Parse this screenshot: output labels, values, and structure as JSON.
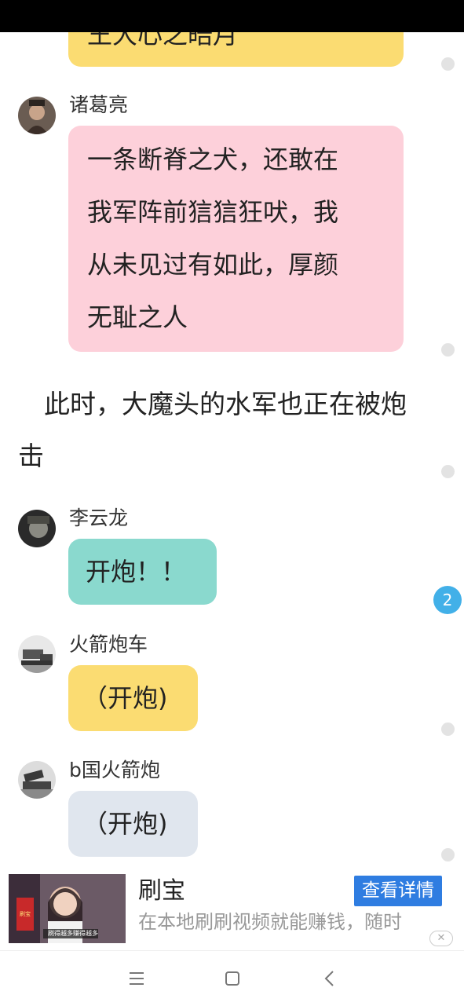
{
  "messages": [
    {
      "text": "王大心之皓月",
      "color": "#fbdc72"
    },
    {
      "name": "诸葛亮",
      "text": "一条断脊之犬，还敢在\n我军阵前狺狺狂吠，我\n从未见过有如此，厚颜\n无耻之人",
      "color": "#fdd0da"
    },
    {
      "name": "李云龙",
      "text": "开炮！！",
      "color": "#8ad9ce"
    },
    {
      "name": "火箭炮车",
      "text": "（开炮)",
      "color": "#fbdc72"
    },
    {
      "name": "b国火箭炮",
      "text": "（开炮)",
      "color": "#e0e6ee"
    }
  ],
  "narration": "　此时，大魔头的水军也正在被炮击",
  "badge": "2",
  "ad": {
    "title": "刷宝",
    "description": "在本地刷刷视频就能赚钱，随时",
    "button": "查看详情",
    "close": "✕",
    "thumb_caption": "刷得越多赚得越多",
    "thumb_badge": "刷宝"
  },
  "icons": {
    "menu": "menu-icon",
    "home": "home-icon",
    "back": "back-icon"
  }
}
